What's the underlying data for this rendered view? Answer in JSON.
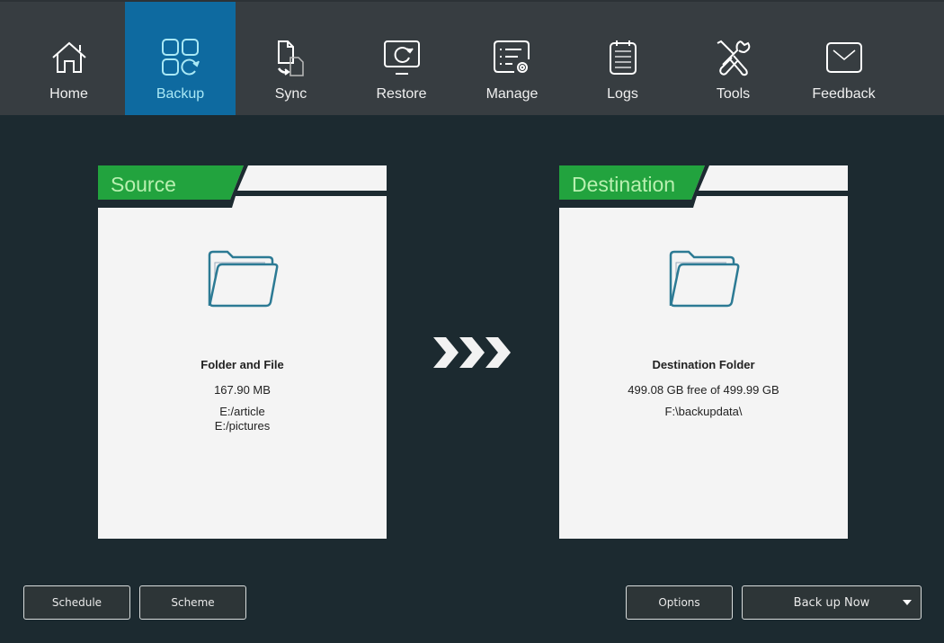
{
  "nav": {
    "active_color": "#0e6aa0",
    "items": [
      {
        "label": "Home",
        "icon": "home-icon",
        "active": false
      },
      {
        "label": "Backup",
        "icon": "backup-icon",
        "active": true
      },
      {
        "label": "Sync",
        "icon": "sync-icon",
        "active": false
      },
      {
        "label": "Restore",
        "icon": "restore-icon",
        "active": false
      },
      {
        "label": "Manage",
        "icon": "manage-icon",
        "active": false
      },
      {
        "label": "Logs",
        "icon": "logs-icon",
        "active": false
      },
      {
        "label": "Tools",
        "icon": "tools-icon",
        "active": false
      },
      {
        "label": "Feedback",
        "icon": "feedback-icon",
        "active": false
      }
    ]
  },
  "source": {
    "title": "Source",
    "heading": "Folder and File",
    "size": "167.90 MB",
    "paths": [
      "E:/article",
      "E:/pictures"
    ]
  },
  "destination": {
    "title": "Destination",
    "heading": "Destination Folder",
    "space": "499.08 GB free of 499.99 GB",
    "path": "F:\\backupdata\\"
  },
  "accent_green": "#22a33e",
  "buttons": {
    "schedule": "Schedule",
    "scheme": "Scheme",
    "options": "Options",
    "backup_now": "Back up Now"
  }
}
